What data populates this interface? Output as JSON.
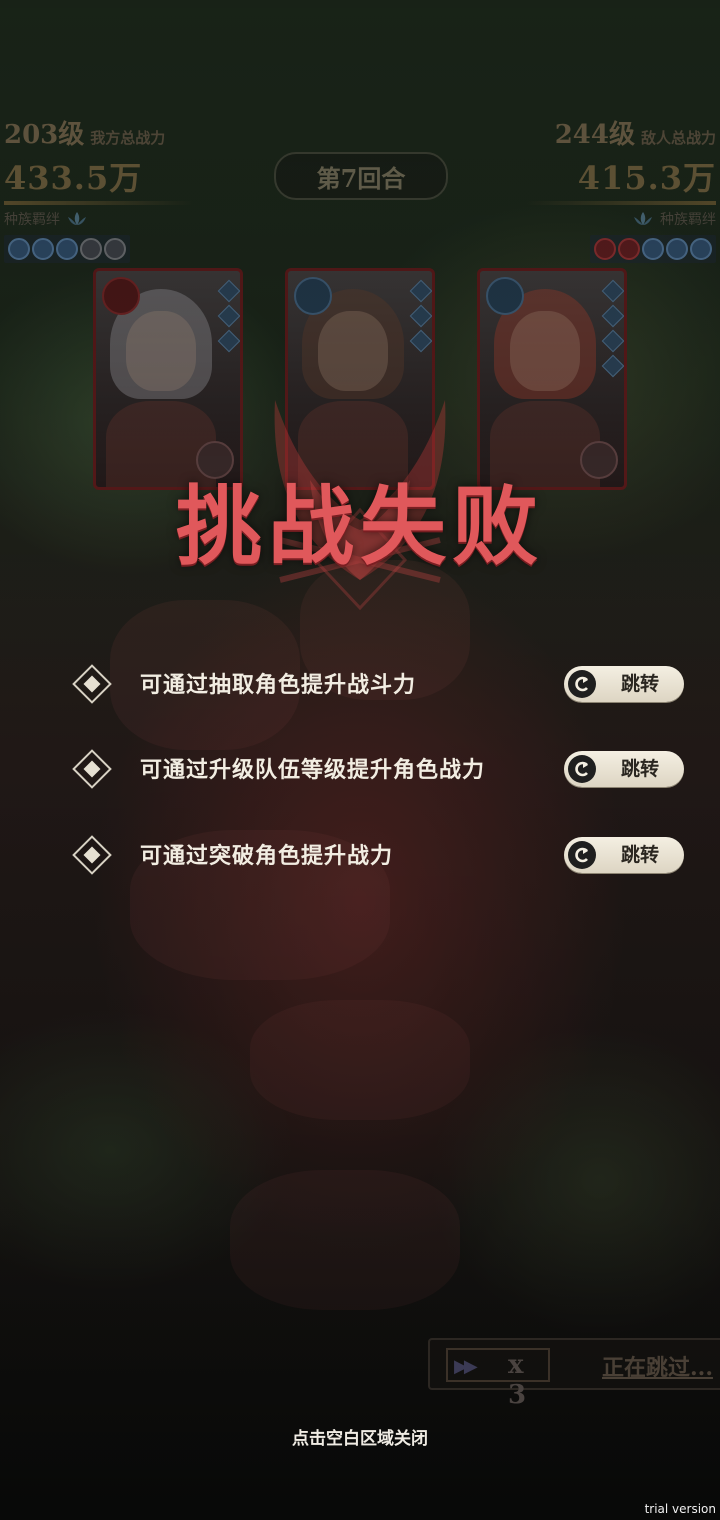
{
  "hud": {
    "left": {
      "level": "203级",
      "label": "我方总战力",
      "power": "433.5万",
      "bond": "种族羁绊"
    },
    "right": {
      "level": "244级",
      "label": "敌人总战力",
      "power": "415.3万",
      "bond": "种族羁绊"
    },
    "round": "第7回合"
  },
  "result": {
    "title": "挑战失败"
  },
  "tips": [
    {
      "text": "可通过抽取角色提升战斗力",
      "button": "跳转"
    },
    {
      "text": "可通过升级队伍等级提升角色战力",
      "button": "跳转"
    },
    {
      "text": "可通过突破角色提升战力",
      "button": "跳转"
    }
  ],
  "speed": {
    "multiplier": "x 3",
    "status": "正在跳过..."
  },
  "footer": {
    "close_hint": "点击空白区域关闭",
    "watermark": "trial version"
  },
  "colors": {
    "defeat_red": "#e0585b",
    "button_bg": "#f4efe2",
    "text_light": "#f2ede2"
  }
}
